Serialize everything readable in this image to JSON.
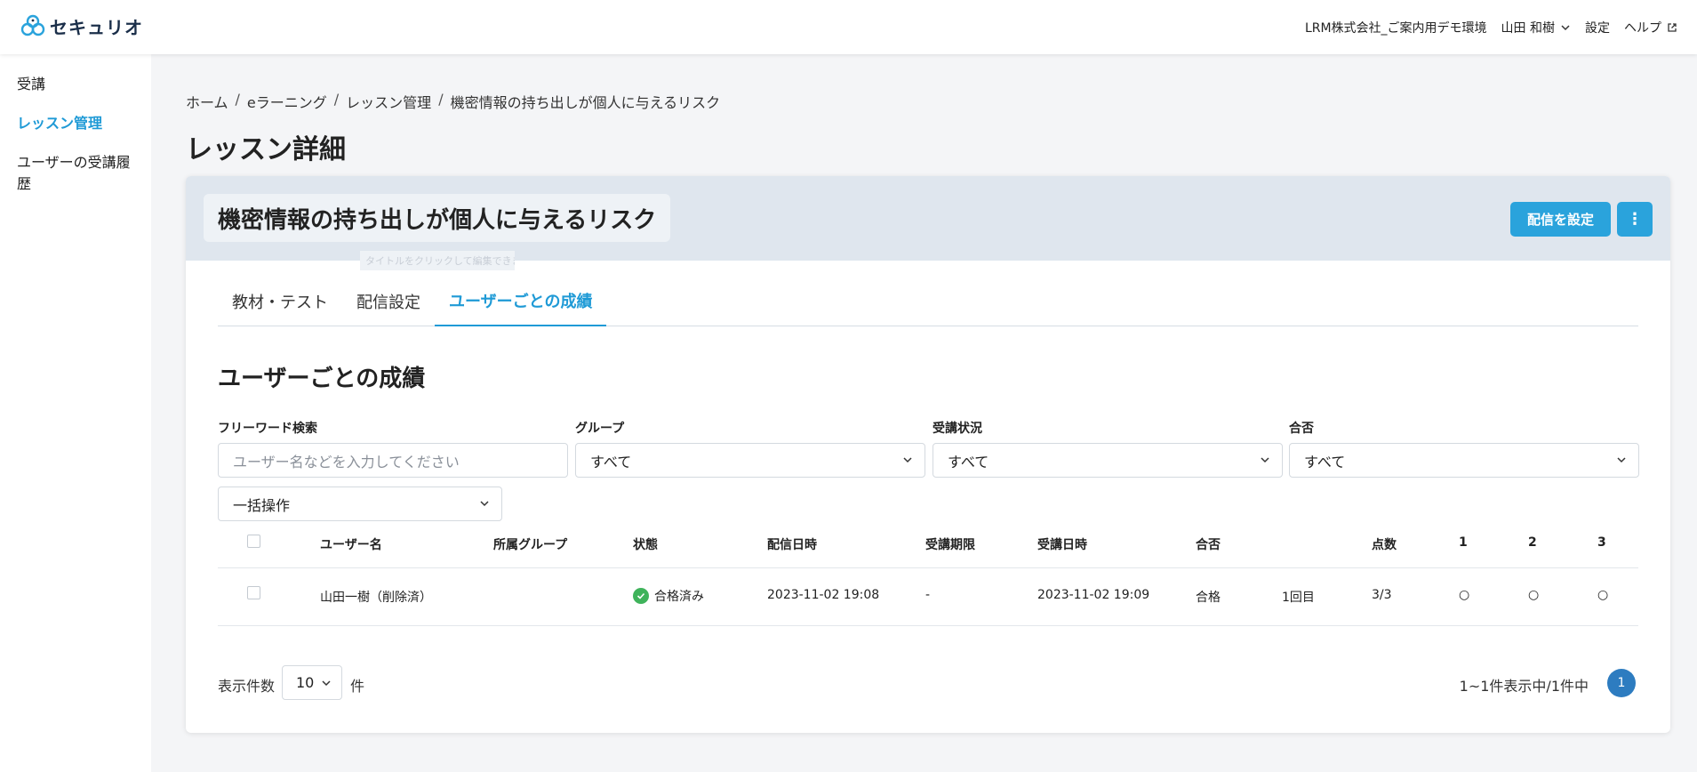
{
  "header": {
    "logo_text": "セキュリオ",
    "company": "LRM株式会社_ご案内用デモ環境",
    "user": "山田 和樹",
    "settings": "設定",
    "help": "ヘルプ"
  },
  "sidebar": {
    "items": [
      {
        "label": "受講"
      },
      {
        "label": "レッスン管理"
      },
      {
        "label": "ユーザーの受講履歴"
      }
    ]
  },
  "breadcrumb": [
    "ホーム",
    "eラーニング",
    "レッスン管理",
    "機密情報の持ち出しが個人に与えるリスク"
  ],
  "breadcrumb_sep": "/",
  "page_title": "レッスン詳細",
  "lesson": {
    "title": "機密情報の持ち出しが個人に与えるリスク",
    "faded_label": "タイトルをクリックして編集できます",
    "deliver_button": "配信を設定",
    "more_button": "⋮"
  },
  "tabs": [
    {
      "label": "教材・テスト"
    },
    {
      "label": "配信設定"
    },
    {
      "label": "ユーザーごとの成績"
    }
  ],
  "section_title": "ユーザーごとの成績",
  "filters": {
    "keyword_label": "フリーワード検索",
    "keyword_placeholder": "ユーザー名などを入力してください",
    "group_label": "グループ",
    "group_value": "すべて",
    "status_label": "受講状況",
    "status_value": "すべて",
    "pass_label": "合否",
    "pass_value": "すべて",
    "bulk_action": "一括操作"
  },
  "table": {
    "headers": {
      "user": "ユーザー名",
      "group": "所属グループ",
      "status": "状態",
      "delivered": "配信日時",
      "deadline": "受講期限",
      "taken": "受講日時",
      "result": "合否",
      "score": "点数",
      "q1": "1",
      "q2": "2",
      "q3": "3"
    },
    "rows": [
      {
        "user": "山田一樹（削除済）",
        "group": "",
        "status": "合格済み",
        "delivered": "2023-11-02 19:08",
        "deadline": "-",
        "taken": "2023-11-02 19:09",
        "result": "合格",
        "attempt": "1回目",
        "score": "3/3",
        "q1": "○",
        "q2": "○",
        "q3": "○"
      }
    ]
  },
  "pagination": {
    "per_page_label": "表示件数",
    "per_page_value": "10",
    "per_page_unit": "件",
    "summary": "1~1件表示中/1件中",
    "current_page": "1"
  },
  "colors": {
    "accent": "#1f9ad6",
    "button": "#2aa3dc",
    "page_active": "#2d7cc0",
    "success": "#3fb35b"
  }
}
